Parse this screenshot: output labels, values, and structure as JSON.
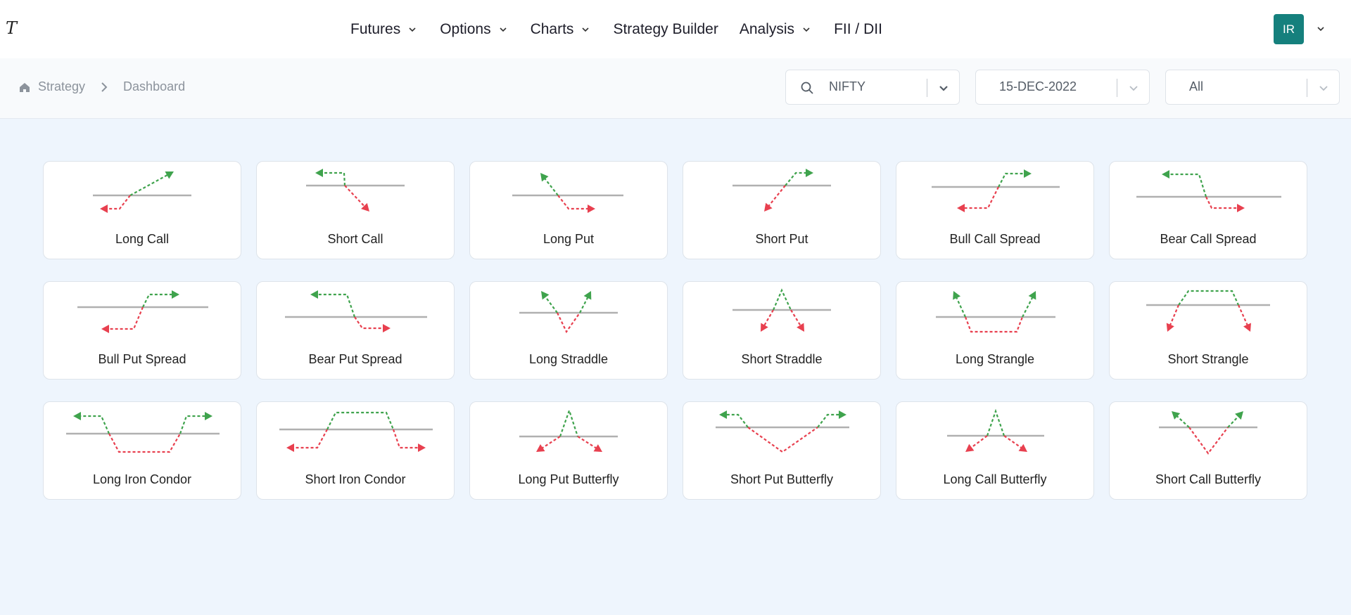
{
  "app": {
    "logo": "T"
  },
  "nav": {
    "items": [
      {
        "label": "Futures",
        "dropdown": true
      },
      {
        "label": "Options",
        "dropdown": true
      },
      {
        "label": "Charts",
        "dropdown": true
      },
      {
        "label": "Strategy Builder",
        "dropdown": false
      },
      {
        "label": "Analysis",
        "dropdown": true
      },
      {
        "label": "FII / DII",
        "dropdown": false
      }
    ],
    "user_initials": "IR"
  },
  "breadcrumb": {
    "items": [
      "Strategy",
      "Dashboard"
    ]
  },
  "filters": {
    "symbol": "NIFTY",
    "expiry": "15-DEC-2022",
    "type": "All"
  },
  "colors": {
    "accent": "#15807d",
    "profit": "#3fa34d",
    "loss": "#e8404f",
    "baseline": "#b0b0b0"
  },
  "strategies": [
    {
      "name": "Long Call",
      "shape": "long-call"
    },
    {
      "name": "Short Call",
      "shape": "short-call"
    },
    {
      "name": "Long Put",
      "shape": "long-put"
    },
    {
      "name": "Short Put",
      "shape": "short-put"
    },
    {
      "name": "Bull Call Spread",
      "shape": "bull-call-spread"
    },
    {
      "name": "Bear Call Spread",
      "shape": "bear-call-spread"
    },
    {
      "name": "Bull Put Spread",
      "shape": "bull-put-spread"
    },
    {
      "name": "Bear Put Spread",
      "shape": "bear-put-spread"
    },
    {
      "name": "Long Straddle",
      "shape": "long-straddle"
    },
    {
      "name": "Short Straddle",
      "shape": "short-straddle"
    },
    {
      "name": "Long Strangle",
      "shape": "long-strangle"
    },
    {
      "name": "Short Strangle",
      "shape": "short-strangle"
    },
    {
      "name": "Long Iron Condor",
      "shape": "long-iron-condor"
    },
    {
      "name": "Short Iron Condor",
      "shape": "short-iron-condor"
    },
    {
      "name": "Long Put Butterfly",
      "shape": "long-put-butterfly"
    },
    {
      "name": "Short Put Butterfly",
      "shape": "short-put-butterfly"
    },
    {
      "name": "Long Call Butterfly",
      "shape": "long-call-butterfly"
    },
    {
      "name": "Short Call Butterfly",
      "shape": "short-call-butterfly"
    }
  ]
}
